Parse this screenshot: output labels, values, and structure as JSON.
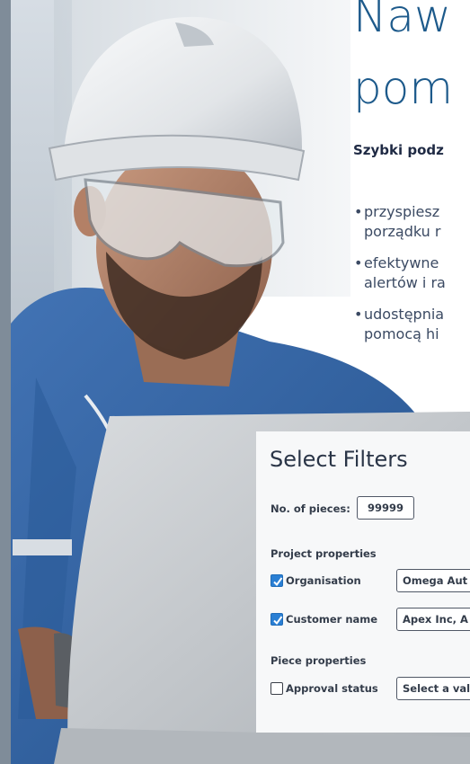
{
  "headline": {
    "line1": "Naw",
    "line2": "pom"
  },
  "subhead": "Szybki podz",
  "bullets": [
    {
      "line1": "przyspiesz",
      "line2": "porządku r"
    },
    {
      "line1": "efektywne",
      "line2": "alertów i ra"
    },
    {
      "line1": "udostępnia",
      "line2": "pomocą hi"
    }
  ],
  "filters_panel": {
    "title": "Select Filters",
    "pieces_label": "No. of pieces:",
    "pieces_value": "99999",
    "project_section": "Project properties",
    "organisation": {
      "label": "Organisation",
      "checked": true,
      "value": "Omega Aut"
    },
    "customer_name": {
      "label": "Customer name",
      "checked": true,
      "value": "Apex Inc, A"
    },
    "piece_section": "Piece properties",
    "approval_status": {
      "label": "Approval status",
      "checked": false,
      "value": "Select a val"
    }
  },
  "colors": {
    "headline": "#1d5a8b",
    "subhead": "#1f2a44",
    "body_text": "#3b4a63",
    "checkbox_checked": "#2a7fd4",
    "workwear_blue": "#2f63a8",
    "helmet_white": "#eef0f2"
  },
  "icons": [
    "checkbox-checked-icon",
    "checkbox-unchecked-icon"
  ]
}
